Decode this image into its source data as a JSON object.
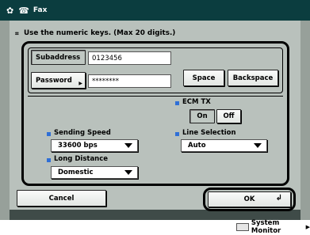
{
  "window": {
    "title": "Fax"
  },
  "instruction": "Use the numeric keys. (Max 20 digits.)",
  "subaddress": {
    "label": "Subaddress",
    "value": "0123456"
  },
  "password": {
    "label": "Password",
    "value": "********"
  },
  "keys": {
    "space": "Space",
    "backspace": "Backspace"
  },
  "ecm": {
    "label": "ECM TX",
    "on": "On",
    "off": "Off"
  },
  "sending_speed": {
    "label": "Sending Speed",
    "value": "33600 bps"
  },
  "line_selection": {
    "label": "Line Selection",
    "value": "Auto"
  },
  "long_distance": {
    "label": "Long Distance",
    "value": "Domestic"
  },
  "actions": {
    "cancel": "Cancel",
    "ok": "OK"
  },
  "status_bar": {
    "system_monitor": "System Monitor"
  },
  "icons": [
    "fax-icon",
    "numeric-keys-icon",
    "enter-icon",
    "system-monitor-icon"
  ],
  "colors": {
    "titlebar": "#0b3d3f",
    "accent_bullet": "#2f6fd6",
    "background": "#b9c1bc"
  }
}
